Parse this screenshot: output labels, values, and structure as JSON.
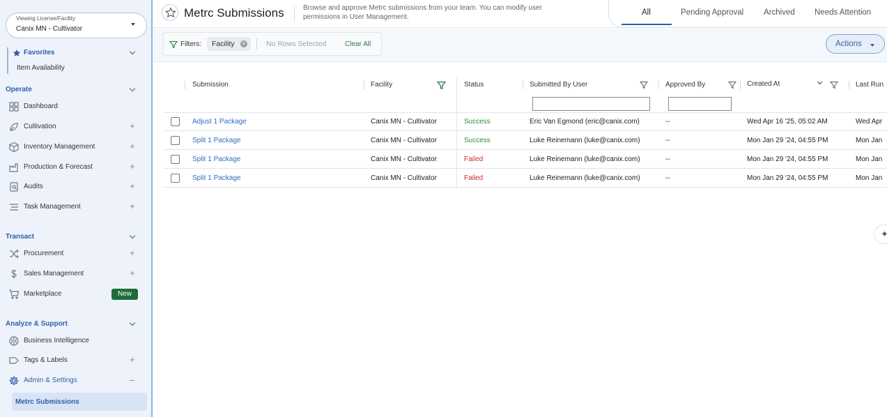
{
  "sidebar": {
    "license_label": "Viewing License/Facility:",
    "license_value": "Canix MN - Cultivator",
    "favorites": {
      "label": "Favorites",
      "items": [
        "Item Availability"
      ]
    },
    "sections": [
      {
        "label": "Operate",
        "items": [
          {
            "label": "Dashboard",
            "icon": "grid-icon",
            "plus": false
          },
          {
            "label": "Cultivation",
            "icon": "leaf-icon",
            "plus": true
          },
          {
            "label": "Inventory Management",
            "icon": "box-icon",
            "plus": true
          },
          {
            "label": "Production & Forecast",
            "icon": "factory-icon",
            "plus": true
          },
          {
            "label": "Audits",
            "icon": "audit-icon",
            "plus": true
          },
          {
            "label": "Task Management",
            "icon": "list-icon",
            "plus": true
          }
        ]
      },
      {
        "label": "Transact",
        "items": [
          {
            "label": "Procurement",
            "icon": "shuffle-icon",
            "plus": true
          },
          {
            "label": "Sales Management",
            "icon": "dollar-icon",
            "plus": true
          },
          {
            "label": "Marketplace",
            "icon": "cart-icon",
            "badge": "New"
          }
        ]
      },
      {
        "label": "Analyze & Support",
        "items": [
          {
            "label": "Business Intelligence",
            "icon": "brain-icon",
            "plus": false
          },
          {
            "label": "Tags & Labels",
            "icon": "tag-icon",
            "plus": true
          },
          {
            "label": "Admin & Settings",
            "icon": "gear-icon",
            "minus": true
          }
        ]
      }
    ],
    "plus_symbol": "+",
    "minus_symbol": "–",
    "active_subitem": "Metrc Submissions"
  },
  "header": {
    "title": "Metrc Submissions",
    "description": "Browse and approve Metrc submissions from your team. You can modify user permissions in User Management.",
    "tabs": [
      "All",
      "Pending Approval",
      "Archived",
      "Needs Attention"
    ],
    "active_tab": "All"
  },
  "toolbar": {
    "filters_label": "Filters:",
    "chip_label": "Facility",
    "chip_close": "×",
    "no_rows": "No Rows Selected",
    "clear_all": "Clear All",
    "actions": "Actions"
  },
  "table": {
    "columns": [
      "Submission",
      "Facility",
      "Status",
      "Submitted By User",
      "Approved By",
      "Created At",
      "Last Run"
    ],
    "rows": [
      {
        "submission": "Adjust 1 Package",
        "facility": "Canix MN - Cultivator",
        "status": "Success",
        "submitted_by": "Eric Van Egmond (eric@canix.com)",
        "approved_by": "--",
        "created_at": "Wed Apr 16 '25, 05:02 AM",
        "last_run": "Wed Apr"
      },
      {
        "submission": "Split 1 Package",
        "facility": "Canix MN - Cultivator",
        "status": "Success",
        "submitted_by": "Luke Reinemann (luke@canix.com)",
        "approved_by": "--",
        "created_at": "Mon Jan 29 '24, 04:55 PM",
        "last_run": "Mon Jan"
      },
      {
        "submission": "Split 1 Package",
        "facility": "Canix MN - Cultivator",
        "status": "Failed",
        "submitted_by": "Luke Reinemann (luke@canix.com)",
        "approved_by": "--",
        "created_at": "Mon Jan 29 '24, 04:55 PM",
        "last_run": "Mon Jan"
      },
      {
        "submission": "Split 1 Package",
        "facility": "Canix MN - Cultivator",
        "status": "Failed",
        "submitted_by": "Luke Reinemann (luke@canix.com)",
        "approved_by": "--",
        "created_at": "Mon Jan 29 '24, 04:55 PM",
        "last_run": "Mon Jan"
      }
    ]
  },
  "assistant_symbol": "✦",
  "colors": {
    "accent": "#2f5fa8",
    "success": "#2b8a3e",
    "failed": "#d02a2a",
    "badge": "#1f6b3b"
  }
}
